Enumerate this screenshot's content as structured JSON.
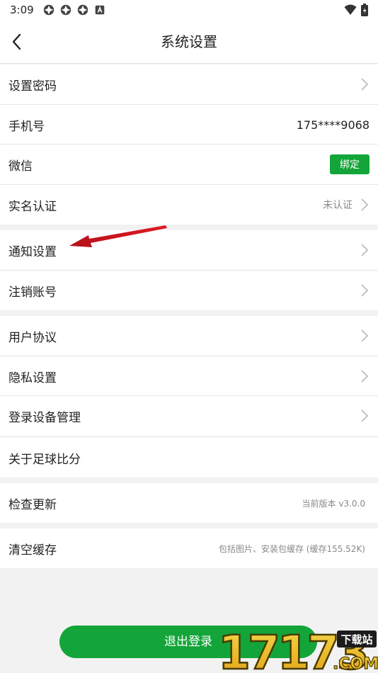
{
  "status_bar": {
    "time": "3:09"
  },
  "header": {
    "title": "系统设置"
  },
  "rows": {
    "password": {
      "label": "设置密码"
    },
    "phone": {
      "label": "手机号",
      "value": "175****9068"
    },
    "wechat": {
      "label": "微信",
      "button": "绑定"
    },
    "realname": {
      "label": "实名认证",
      "value": "未认证"
    },
    "notify": {
      "label": "通知设置"
    },
    "cancel": {
      "label": "注销账号"
    },
    "agreement": {
      "label": "用户协议"
    },
    "privacy": {
      "label": "隐私设置"
    },
    "devices": {
      "label": "登录设备管理"
    },
    "about": {
      "label": "关于足球比分"
    },
    "update": {
      "label": "检查更新",
      "value": "当前版本 v3.0.0"
    },
    "cache": {
      "label": "清空缓存",
      "value": "包括图片、安装包缓存 (缓存155.52K)"
    }
  },
  "logout": {
    "label": "退出登录"
  },
  "watermark": {
    "text": "17173",
    "sub": "下载站",
    "domain": ".COM"
  },
  "colors": {
    "accent": "#13a539",
    "annotation": "#d9141c"
  }
}
